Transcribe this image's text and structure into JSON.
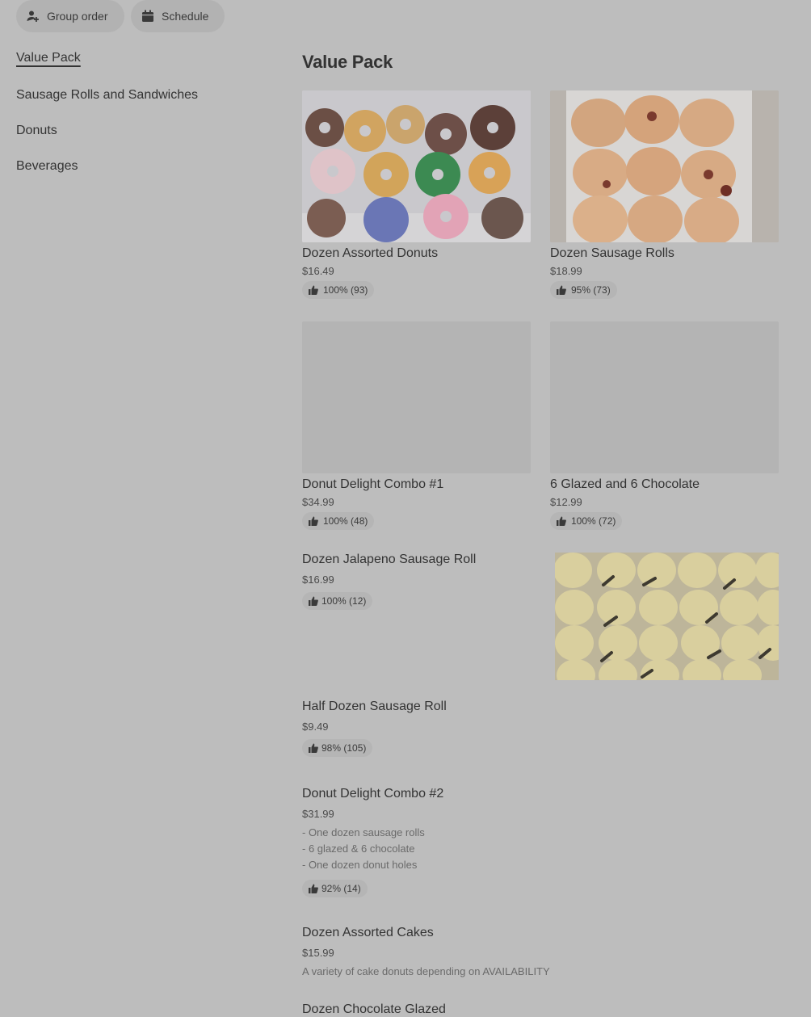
{
  "toolbar": {
    "group_order_label": "Group order",
    "schedule_label": "Schedule"
  },
  "sidebar": {
    "items": [
      {
        "label": "Value Pack",
        "active": true
      },
      {
        "label": "Sausage Rolls and Sandwiches",
        "active": false
      },
      {
        "label": "Donuts",
        "active": false
      },
      {
        "label": "Beverages",
        "active": false
      }
    ]
  },
  "section": {
    "title": "Value Pack"
  },
  "grid_items": [
    {
      "name": "Dozen Assorted Donuts",
      "price": "$16.49",
      "rating": "100% (93)",
      "image": "assorted-donuts-photo"
    },
    {
      "name": "Dozen Sausage Rolls",
      "price": "$18.99",
      "rating": "95% (73)",
      "image": "sausage-rolls-photo"
    },
    {
      "name": "Donut Delight Combo #1",
      "price": "$34.99",
      "rating": "100% (48)",
      "image": "placeholder"
    },
    {
      "name": "6 Glazed and 6 Chocolate",
      "price": "$12.99",
      "rating": "100% (72)",
      "image": "placeholder"
    }
  ],
  "list_items": [
    {
      "name": "Dozen Jalapeno Sausage Roll",
      "price": "$16.99",
      "rating": "100% (12)",
      "image": "jalapeno-sausage-roll-photo"
    },
    {
      "name": "Half Dozen Sausage Roll",
      "price": "$9.49",
      "rating": "98% (105)"
    },
    {
      "name": "Donut Delight Combo #2",
      "price": "$31.99",
      "desc_lines": [
        "- One dozen sausage rolls",
        "- 6 glazed & 6 chocolate",
        "- One dozen donut holes"
      ],
      "rating": "92% (14)"
    },
    {
      "name": "Dozen Assorted Cakes",
      "price": "$15.99",
      "desc_lines": [
        "A variety of cake donuts depending on AVAILABILITY"
      ]
    },
    {
      "name": "Dozen Chocolate Glazed",
      "price": ""
    }
  ],
  "colors": {
    "overlay_bg": "#bdbdbd",
    "pill_bg": "#b2b2b2",
    "text": "#333333"
  }
}
